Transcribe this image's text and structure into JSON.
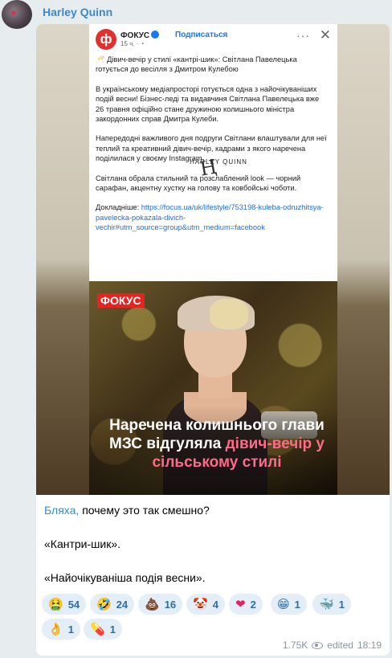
{
  "channel": {
    "name": "Harley Quinn"
  },
  "post": {
    "publisher": "ФОКУС",
    "subscribe_label": "Подписаться",
    "time": "15 ч. · ◔",
    "logo_glyph": "ф",
    "more": "···",
    "close": "✕",
    "headline": "🥂 Дівич-вечір у стилі «кантрі-шик»: Світлана Павелецька готується до весілля з Дмитром Кулебою",
    "para1": "В українському медіапросторі готується одна з найочікуваніших подій весни! Бізнес-леді та видавчиня Світлана Павелецька вже 26 травня офіційно стане дружиною колишнього міністра закордонних справ Дмитра Кулеби.",
    "para2": "Напередодні важливого дня подруги Світлани влаштували для неї теплий та креативний дівич-вечір, кадрами з якого наречена поділилася у своєму Instagram.",
    "para3": "Світлана обрала стильний та розслаблений look — чорний сарафан, акцентну хустку на голову та ковбойські чоботи.",
    "more_label": "Докладніше: ",
    "link": "https://focus.ua/uk/lifestyle/753198-kuleba-odruzhitsya-pavelecka-pokazala-divich-vechir#utm_source=group&utm_medium=facebook",
    "watermark": "HARLEY QUINN"
  },
  "photo": {
    "badge": "ФОКУС",
    "caption_white": "Наречена колишнього глави МЗС відгуляла ",
    "caption_pink": "дівич-вечір у сільському стилі"
  },
  "message": {
    "line1_link": "Бляха,",
    "line1_rest": " почему это так смешно?",
    "line2": "«Кантри-шик».",
    "line3": "«Найочікуваніша подія весни»."
  },
  "reactions": [
    {
      "emoji": "🤮",
      "count": "54"
    },
    {
      "emoji": "🤣",
      "count": "24"
    },
    {
      "emoji": "💩",
      "count": "16"
    },
    {
      "emoji": "🤡",
      "count": "4"
    },
    {
      "emoji": "❤",
      "count": "2"
    },
    {
      "emoji": "😁",
      "count": "1"
    },
    {
      "emoji": "🐳",
      "count": "1"
    },
    {
      "emoji": "👌",
      "count": "1"
    },
    {
      "emoji": "💊",
      "count": "1"
    }
  ],
  "footer": {
    "views": "1.75K",
    "edited": "edited",
    "time": "18:19"
  }
}
